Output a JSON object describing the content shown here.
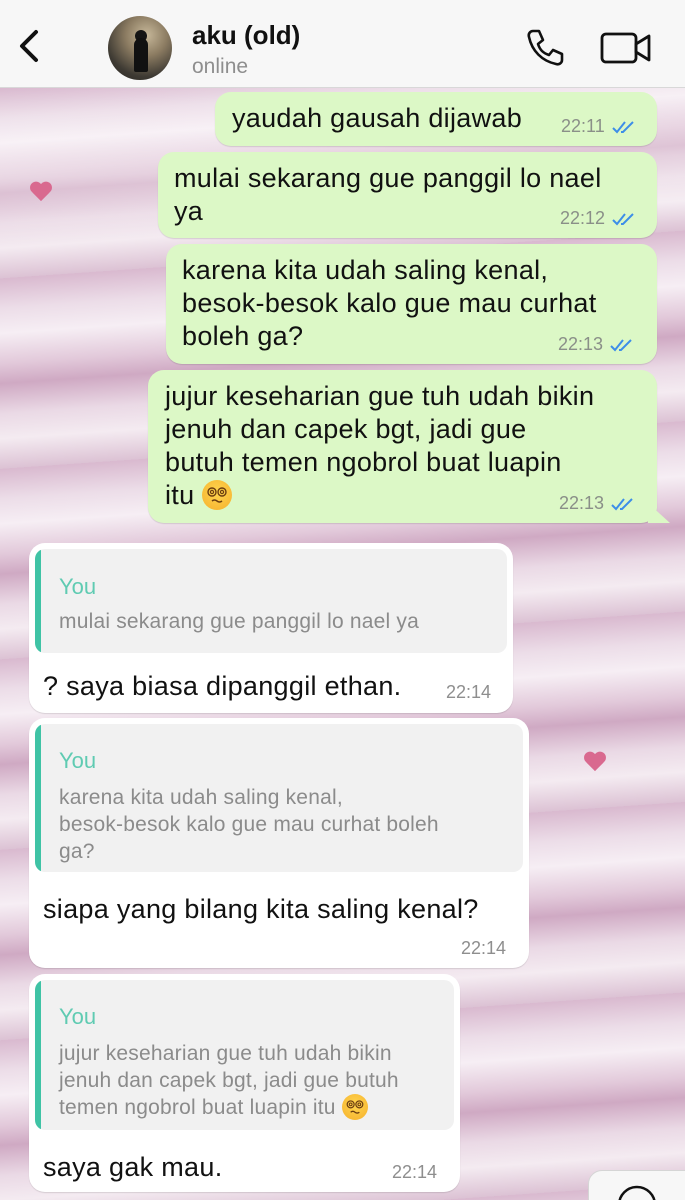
{
  "header": {
    "contact_name": "aku (old)",
    "status": "online",
    "back_icon": "chevron-left-icon",
    "call_icon": "phone-icon",
    "video_icon": "video-camera-icon"
  },
  "colors": {
    "outgoing_bubble": "#dcf8c6",
    "incoming_bubble": "#ffffff",
    "read_ticks": "#3d8ee8",
    "quote_accent": "#3fc3a5"
  },
  "outgoing": [
    {
      "text": "yaudah gausah dijawab",
      "time": "22:11"
    },
    {
      "line1": "mulai sekarang gue panggil lo nael",
      "line2": "ya",
      "time": "22:12"
    },
    {
      "line1": "karena kita udah saling kenal,",
      "line2": "besok-besok kalo gue mau curhat",
      "line3": "boleh ga?",
      "time": "22:13"
    },
    {
      "line1": "jujur keseharian gue tuh udah bikin",
      "line2": "jenuh dan capek bgt, jadi gue",
      "line3": "butuh temen ngobrol buat luapin",
      "line4": "itu",
      "emoji": "face-with-spiral-eyes",
      "time": "22:13"
    }
  ],
  "incoming": [
    {
      "quote_author": "You",
      "quote_line1": "mulai sekarang gue panggil lo nael ya",
      "text": "? saya biasa dipanggil ethan.",
      "time": "22:14"
    },
    {
      "quote_author": "You",
      "quote_line1": "karena kita udah saling kenal,",
      "quote_line2": "besok-besok kalo gue mau curhat boleh",
      "quote_line3": "ga?",
      "text": "siapa yang bilang kita saling kenal?",
      "time": "22:14"
    },
    {
      "quote_author": "You",
      "quote_line1": "jujur keseharian gue tuh udah bikin",
      "quote_line2": "jenuh dan capek bgt, jadi gue butuh",
      "quote_line3": "temen ngobrol buat luapin itu",
      "quote_emoji": "face-with-spiral-eyes",
      "text": "saya gak mau.",
      "time": "22:14"
    }
  ]
}
